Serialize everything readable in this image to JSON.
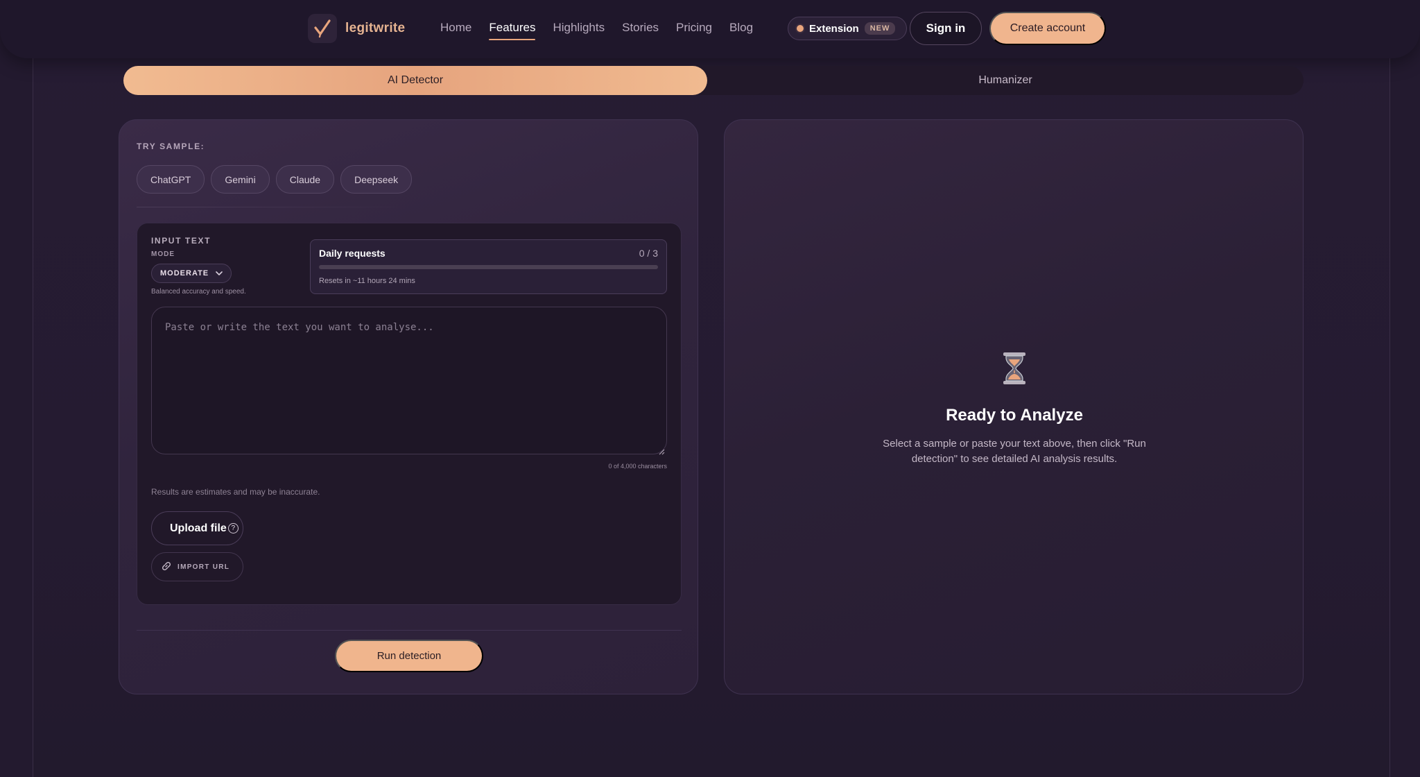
{
  "brand": {
    "name": "legitwrite"
  },
  "nav": {
    "links": [
      {
        "label": "Home"
      },
      {
        "label": "Features"
      },
      {
        "label": "Highlights"
      },
      {
        "label": "Stories"
      },
      {
        "label": "Pricing"
      },
      {
        "label": "Blog"
      }
    ],
    "active": "Features",
    "extension": {
      "label": "Extension",
      "badge": "NEW"
    },
    "sign_in": "Sign in",
    "create_account": "Create account"
  },
  "tabs": {
    "ai_detector": "AI Detector",
    "humanizer": "Humanizer"
  },
  "samples": {
    "label": "TRY SAMPLE:",
    "items": [
      "ChatGPT",
      "Gemini",
      "Claude",
      "Deepseek"
    ]
  },
  "input": {
    "label": "INPUT TEXT",
    "mode_label": "MODE",
    "mode_value": "MODERATE",
    "mode_desc": "Balanced accuracy and speed.",
    "placeholder": "Paste or write the text you want to analyse...",
    "char_count": "0 of 4,000 characters",
    "disclaimer": "Results are estimates and may be inaccurate.",
    "upload": "Upload file",
    "import_url": "IMPORT URL"
  },
  "daily": {
    "title": "Daily requests",
    "count": "0 / 3",
    "used_fraction": 0,
    "reset": "Resets in ~11 hours 24 mins"
  },
  "run_button": "Run detection",
  "result": {
    "title": "Ready to Analyze",
    "description": "Select a sample or paste your text above, then click \"Run detection\" to see detailed AI analysis results."
  },
  "colors": {
    "accent": "#f0b58e",
    "background": "#231a2f"
  }
}
